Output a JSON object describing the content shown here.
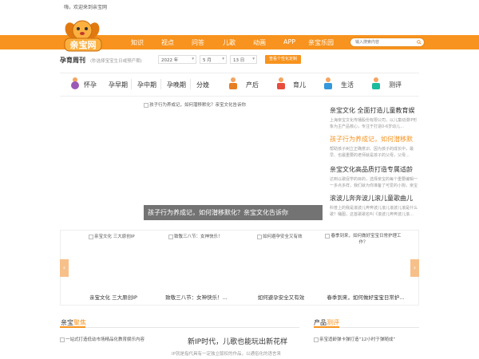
{
  "top": {
    "greeting": "嗨，欢迎来到亲宝网"
  },
  "logo": {
    "text": "亲宝网"
  },
  "nav": {
    "items": [
      "知识",
      "视点",
      "问答",
      "儿歌",
      "动画",
      "APP",
      "亲宝乐园"
    ],
    "search_placeholder": "输入搜索内容"
  },
  "pregnancy": {
    "title": "孕育周刊",
    "tip": "(秒选择宝宝生日或预产期)",
    "year": "2022 年",
    "month": "5 月",
    "day": "13 日",
    "button": "查看个性化定制"
  },
  "stages": {
    "left": [
      "怀孕",
      "孕早期",
      "孕中期",
      "孕晚期",
      "分娩"
    ],
    "right": [
      "产后",
      "育儿",
      "生活",
      "测评"
    ]
  },
  "banner": {
    "image_label": "孩子行为养成记，如何潜移默化？亲宝文化告诉你",
    "caption": "孩子行为养成记，如何潜移默化？亲宝文化告诉你"
  },
  "news": [
    {
      "title": "亲宝文化 全面打造儿童教育娱",
      "summary": "上海亲宝文化传播股份有限公司，以儿童动漫IP形象为主产品核心，专注于打造0-6岁幼儿…",
      "hot": false
    },
    {
      "title": "孩子行为养成记，如何潜移默",
      "summary": "帮助孩子树立正确意识、因为孩子的成长中，最早、也最重要的老师就是孩子的父母，父母…",
      "hot": true
    },
    {
      "title": "亲宝文化高品质打造专属适龄",
      "summary": "达到以歌促学的目的，选择亲宝的每个重要编辑一一多点多样，我们就为你准备了可爱的小狗，亲宝文化…",
      "hot": false
    },
    {
      "title": "滚波儿奔奔波儿滚儿童歌曲儿",
      "summary": "科普上的我是滚波儿奔奔波儿滚儿滚波儿滚是什么歌？桶图，这首歌歌名叫《滚波儿奔奔波儿滚…",
      "hot": false
    }
  ],
  "carousel": [
    {
      "img": "亲宝文化 三大原创IP",
      "caption": "亲宝文化 三大原创IP"
    },
    {
      "img": "致敬三八节：女神快乐！",
      "caption": "致敬三八节：女神快乐！..."
    },
    {
      "img": "如何避孕安全又有效",
      "caption": "如何避孕安全又有效"
    },
    {
      "img": "春季到来，如何做好宝宝日常护理工作？",
      "caption": "春季到来，如何做好宝宝日常护..."
    }
  ],
  "section_focus": {
    "title_a": "亲宝",
    "title_b": "聚焦",
    "thumb": "一站式打造低幼市场精品化教育娱乐内容",
    "headline": "新IP时代，儿歌也能玩出新花样",
    "sub": "IP就是指代具有一定独立版权的作品，以通俗化的语言来"
  },
  "section_review": {
    "title_a": "产品",
    "title_b": "测评",
    "thumb": "亲宝适龄弹卡弹打造“12小时于弹随成”"
  },
  "colors": {
    "brand": "#f7931e",
    "text": "#333333"
  }
}
